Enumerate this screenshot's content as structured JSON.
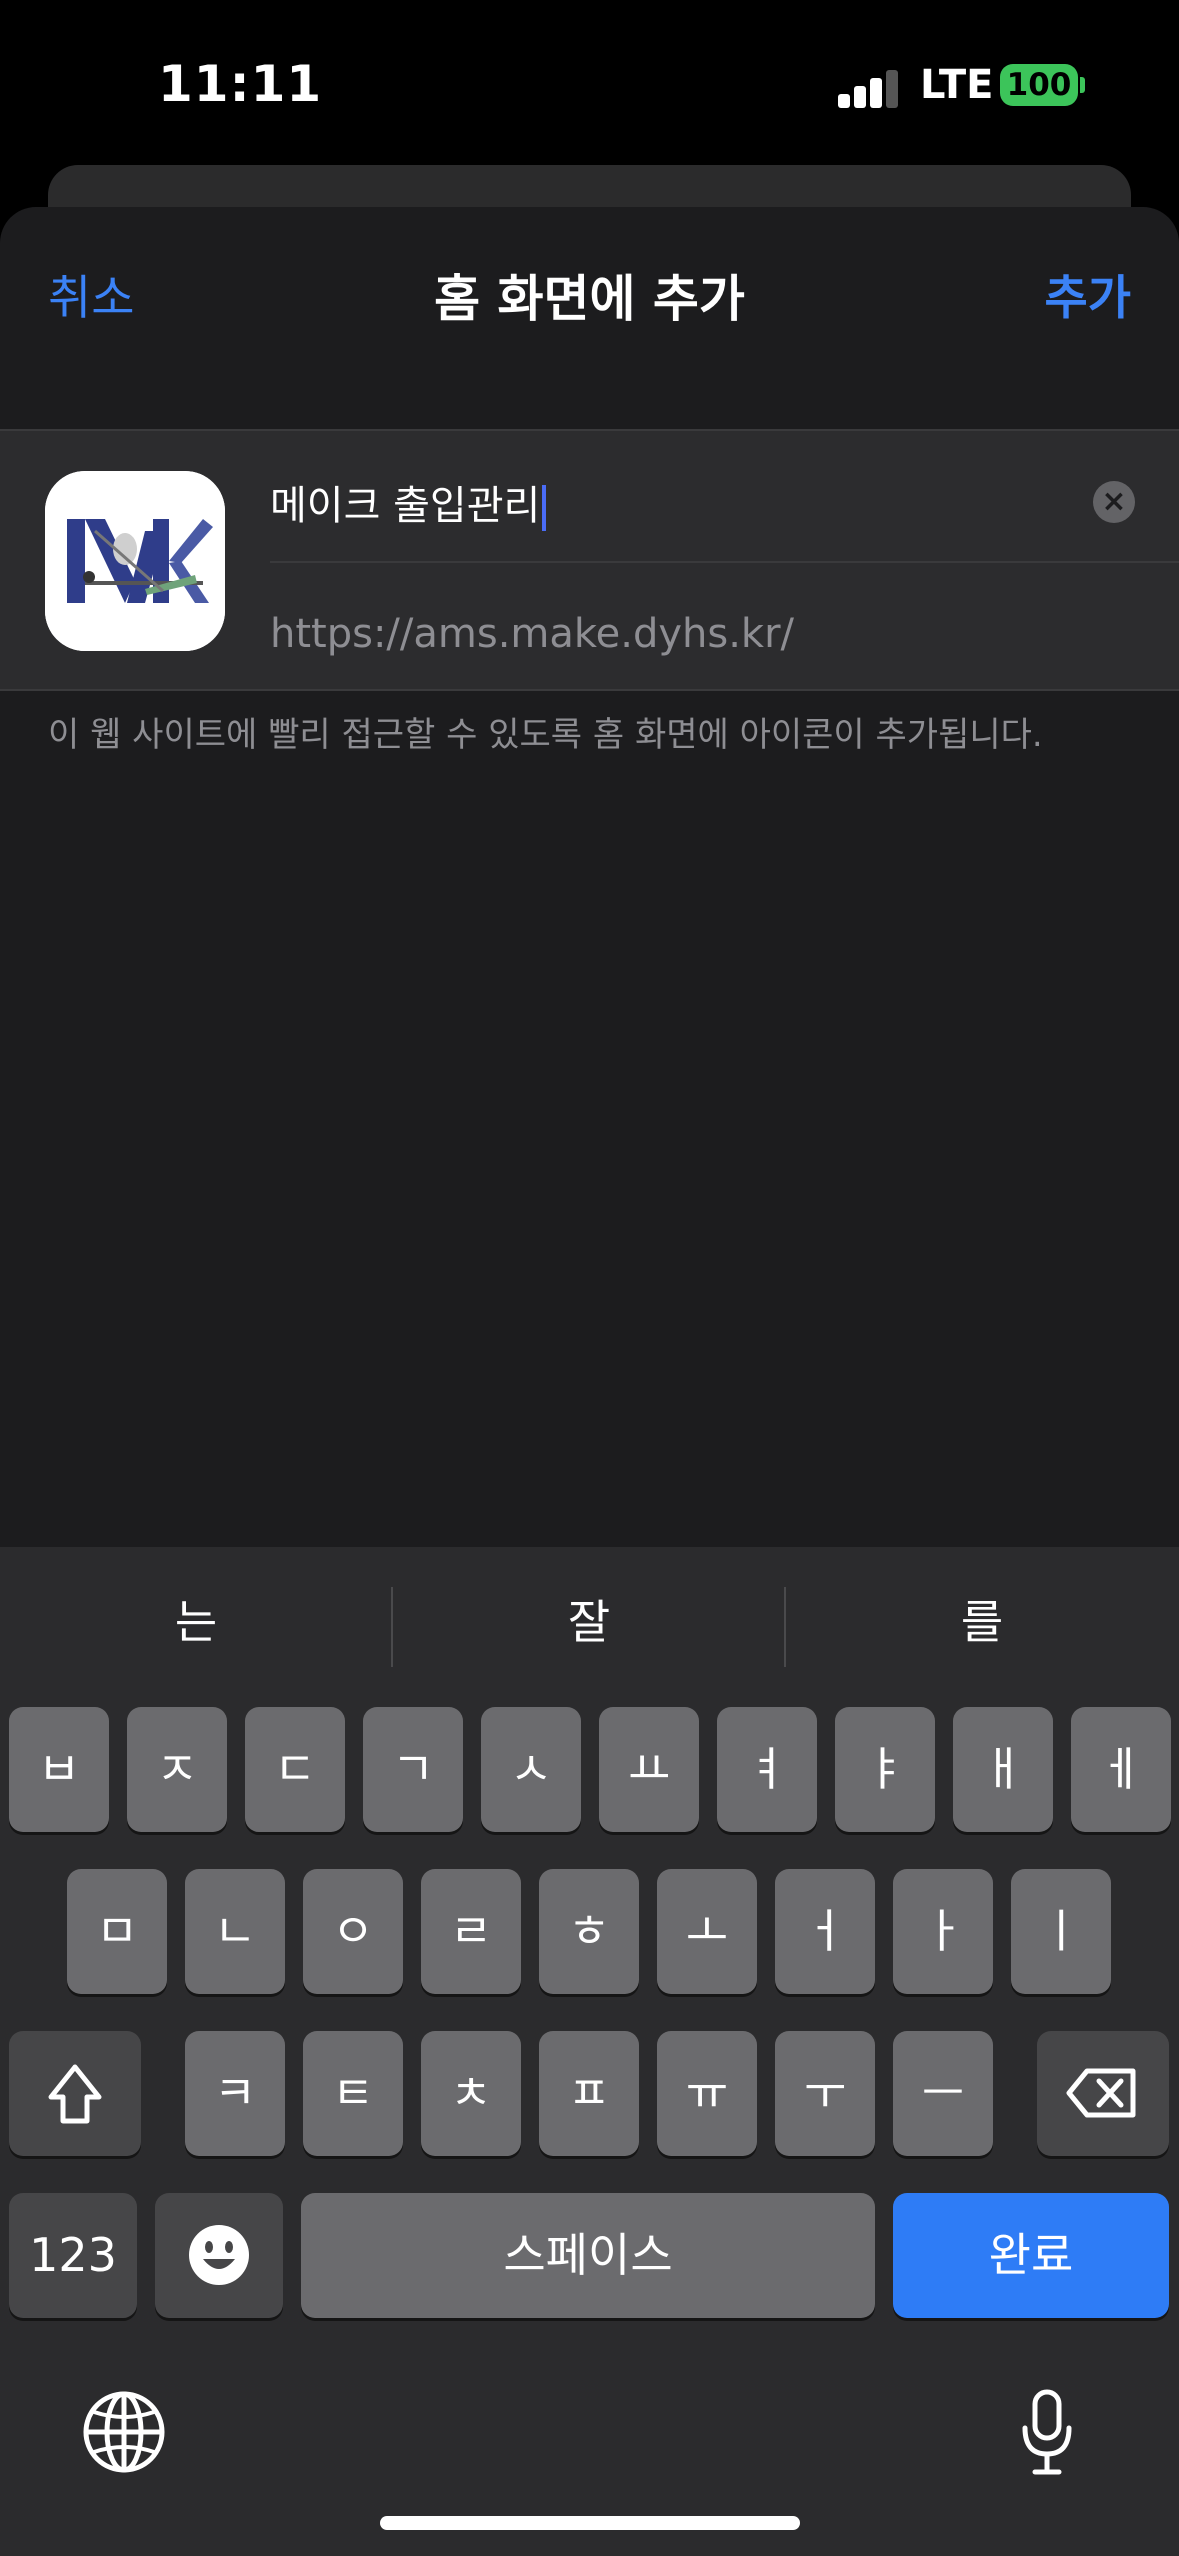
{
  "status_bar": {
    "time": "11:11",
    "network": "LTE",
    "battery": "100"
  },
  "nav": {
    "cancel": "취소",
    "title": "홈 화면에 추가",
    "add": "추가"
  },
  "form": {
    "name_value": "메이크 출입관리",
    "url_value": "https://ams.make.dyhs.kr/",
    "clear_icon": "clear-circle-icon"
  },
  "help_text": "이 웹 사이트에 빨리 접근할 수 있도록 홈 화면에 아이콘이 추가됩니다.",
  "keyboard": {
    "suggestions": [
      "는",
      "잘",
      "를"
    ],
    "row1": [
      "ㅂ",
      "ㅈ",
      "ㄷ",
      "ㄱ",
      "ㅅ",
      "ㅛ",
      "ㅕ",
      "ㅑ",
      "ㅐ",
      "ㅔ"
    ],
    "row2": [
      "ㅁ",
      "ㄴ",
      "ㅇ",
      "ㄹ",
      "ㅎ",
      "ㅗ",
      "ㅓ",
      "ㅏ",
      "ㅣ"
    ],
    "row3": [
      "ㅋ",
      "ㅌ",
      "ㅊ",
      "ㅍ",
      "ㅠ",
      "ㅜ",
      "ㅡ"
    ],
    "numbers_key": "123",
    "space_key": "스페이스",
    "done_key": "완료",
    "icons": {
      "shift": "shift-icon",
      "backspace": "backspace-icon",
      "emoji": "emoji-icon",
      "globe": "globe-icon",
      "mic": "microphone-icon"
    }
  },
  "colors": {
    "accent": "#3b82f6",
    "done_key": "#2e7cf6",
    "battery": "#3cc45a"
  }
}
